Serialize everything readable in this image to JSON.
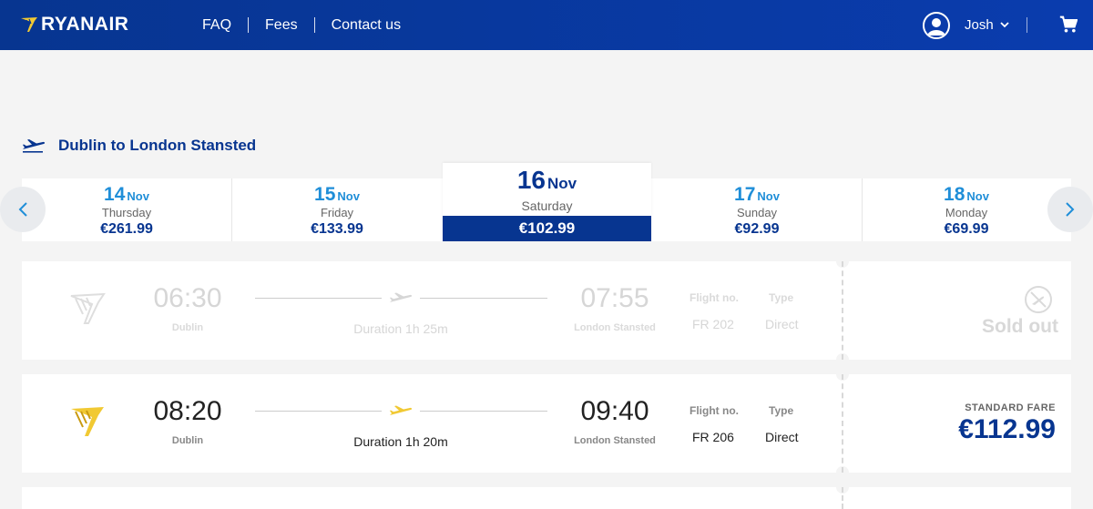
{
  "header": {
    "logo_text": "RYANAIR",
    "nav": [
      "FAQ",
      "Fees",
      "Contact us"
    ],
    "user_name": "Josh"
  },
  "route": {
    "title": "Dublin to London Stansted"
  },
  "dates": [
    {
      "day": "14",
      "month": "Nov",
      "weekday": "Thursday",
      "price": "€261.99"
    },
    {
      "day": "15",
      "month": "Nov",
      "weekday": "Friday",
      "price": "€133.99"
    },
    {
      "day": "16",
      "month": "Nov",
      "weekday": "Saturday",
      "price": "€102.99",
      "selected": true
    },
    {
      "day": "17",
      "month": "Nov",
      "weekday": "Sunday",
      "price": "€92.99"
    },
    {
      "day": "18",
      "month": "Nov",
      "weekday": "Monday",
      "price": "€69.99"
    }
  ],
  "flights": [
    {
      "depart_time": "06:30",
      "depart_place": "Dublin",
      "arrive_time": "07:55",
      "arrive_place": "London Stansted",
      "duration": "Duration 1h 25m",
      "flight_no_label": "Flight no.",
      "flight_no": "FR 202",
      "type_label": "Type",
      "type": "Direct",
      "status": "Sold out"
    },
    {
      "depart_time": "08:20",
      "depart_place": "Dublin",
      "arrive_time": "09:40",
      "arrive_place": "London Stansted",
      "duration": "Duration 1h 20m",
      "flight_no_label": "Flight no.",
      "flight_no": "FR 206",
      "type_label": "Type",
      "type": "Direct",
      "fare_label": "STANDARD FARE",
      "fare_price": "€112.99"
    }
  ],
  "colors": {
    "brand_blue": "#073590",
    "accent_blue": "#1f8ed8",
    "harp_yellow": "#f1c933"
  }
}
